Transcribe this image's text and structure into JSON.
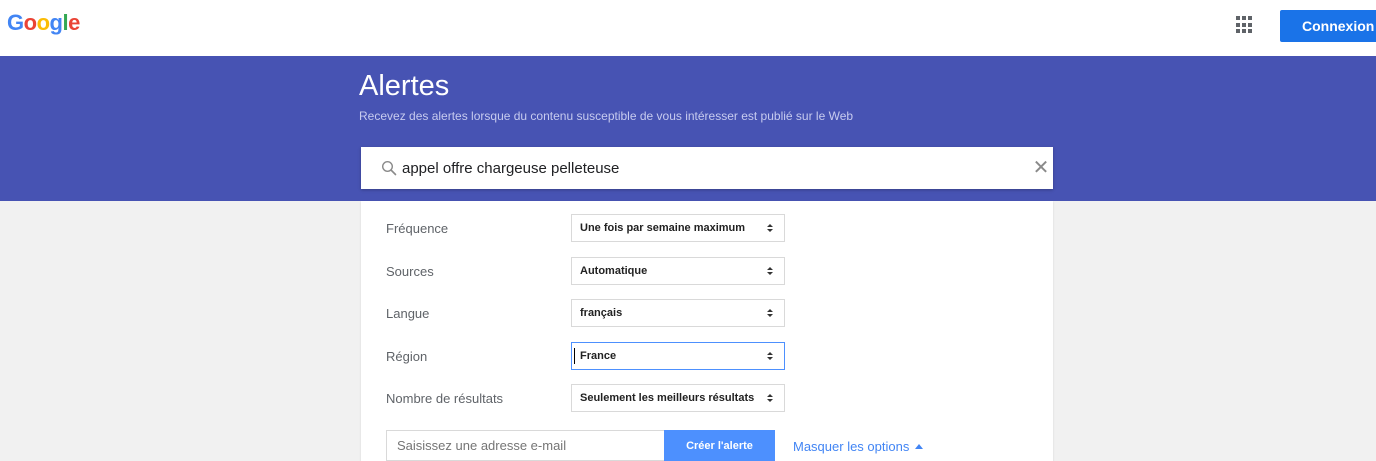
{
  "header": {
    "logo": {
      "letters": [
        "G",
        "o",
        "o",
        "g",
        "l",
        "e"
      ]
    },
    "apps_icon": "apps-grid-icon",
    "signin_label": "Connexion"
  },
  "banner": {
    "title": "Alertes",
    "subtitle": "Recevez des alertes lorsque du contenu susceptible de vous intéresser est publié sur le Web"
  },
  "search": {
    "value": "appel offre chargeuse pelleteuse",
    "icon": "search-icon",
    "clear_icon": "close-icon"
  },
  "options": {
    "rows": [
      {
        "label": "Fréquence",
        "value": "Une fois par semaine maximum"
      },
      {
        "label": "Sources",
        "value": "Automatique"
      },
      {
        "label": "Langue",
        "value": "français"
      },
      {
        "label": "Région",
        "value": "France"
      },
      {
        "label": "Nombre de résultats",
        "value": "Seulement les meilleurs résultats"
      }
    ]
  },
  "footer": {
    "email_placeholder": "Saisissez une adresse e-mail",
    "create_label": "Créer l'alerte",
    "hide_options_label": "Masquer les options"
  },
  "colors": {
    "banner": "#4753b3",
    "primary_button": "#1a73e8",
    "create_button": "#4d90fe",
    "link": "#4285f4"
  }
}
